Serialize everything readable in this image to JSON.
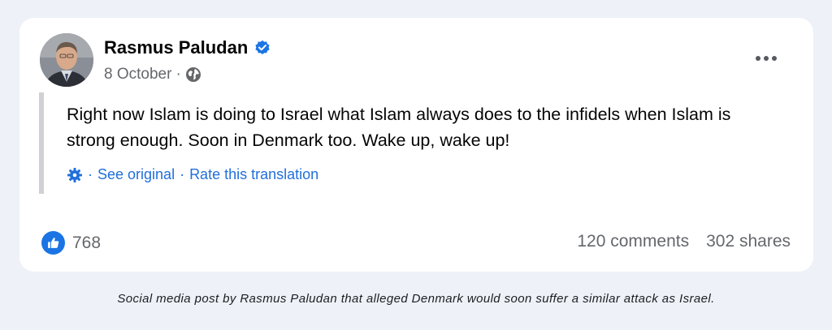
{
  "post": {
    "author": "Rasmus Paludan",
    "date": "8 October",
    "date_separator": "·",
    "text": "Right now Islam is doing to Israel what Islam always does to the infidels when Islam is strong enough. Soon in Denmark too. Wake up, wake up!",
    "translation": {
      "separator": "·",
      "see_original": "See original",
      "rate_translation": "Rate this translation"
    },
    "reactions_count": "768",
    "comments": "120 comments",
    "shares": "302 shares"
  },
  "caption": "Social media post by Rasmus Paludan that alleged Denmark would soon suffer a similar attack as Israel.",
  "icons": {
    "verified": "verified-badge-icon",
    "privacy": "globe-icon",
    "more": "more-options-icon",
    "translate": "gear-icon",
    "like": "thumbs-up-icon"
  },
  "colors": {
    "accent": "#1b74e4",
    "link": "#216fdb",
    "muted_text": "#65676b",
    "background": "#eef1f8"
  }
}
